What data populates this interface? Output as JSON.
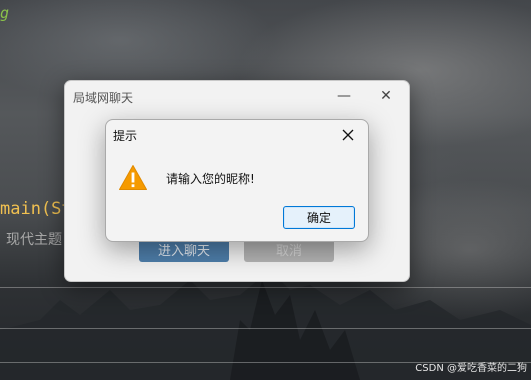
{
  "background": {
    "code_line_top": "g",
    "code_line_main": "main(St",
    "code_comment": "现代主题",
    "watermark": "CSDN @爱吃香菜的二狗"
  },
  "main_window": {
    "title": "局域网聊天",
    "minimize_glyph": "—",
    "close_glyph": "✕",
    "join_button_label": "进入聊天",
    "cancel_button_label": "取消"
  },
  "alert_dialog": {
    "title": "提示",
    "message": "请输入您的昵称!",
    "ok_button_label": "确定",
    "icon": "warning-icon",
    "warning_color": "#f59a00"
  }
}
